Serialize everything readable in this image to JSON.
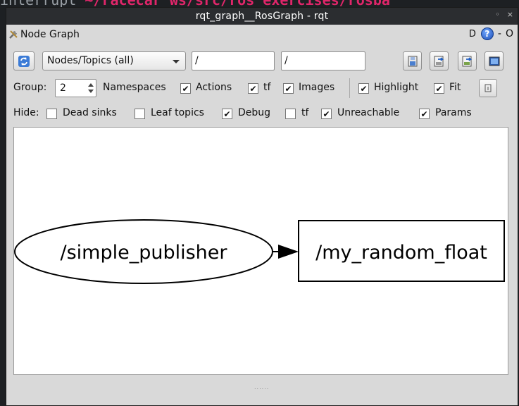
{
  "window": {
    "title": "rqt_graph__RosGraph - rqt",
    "controls": [
      "◦",
      "×"
    ]
  },
  "background": {
    "prefix": "interrupt",
    "path": "~/racecar_ws/src/ros_exercises/rosba"
  },
  "panel": {
    "title": "Node Graph",
    "d_label": "D",
    "help": "?",
    "minus": "-",
    "zero": "O"
  },
  "toolbar": {
    "view_mode": "Nodes/Topics (all)",
    "node_filter": "/",
    "topic_filter": "/"
  },
  "options": {
    "group_label": "Group:",
    "group_value": "2",
    "namespaces": "Namespaces",
    "actions": "Actions",
    "tf": "tf",
    "images": "Images",
    "highlight": "Highlight",
    "fit": "Fit"
  },
  "hide": {
    "label": "Hide:",
    "dead_sinks": "Dead sinks",
    "leaf_topics": "Leaf topics",
    "debug": "Debug",
    "tf": "tf",
    "unreachable": "Unreachable",
    "params": "Params"
  },
  "checks": {
    "namespaces": true,
    "actions": true,
    "tf": true,
    "highlight": true,
    "fit": true,
    "dead_sinks": false,
    "leaf_topics": false,
    "debug": true,
    "hide_tf": false,
    "unreachable": true,
    "params": true
  },
  "graph": {
    "node": "/simple_publisher",
    "topic": "/my_random_float"
  },
  "grip": "......"
}
